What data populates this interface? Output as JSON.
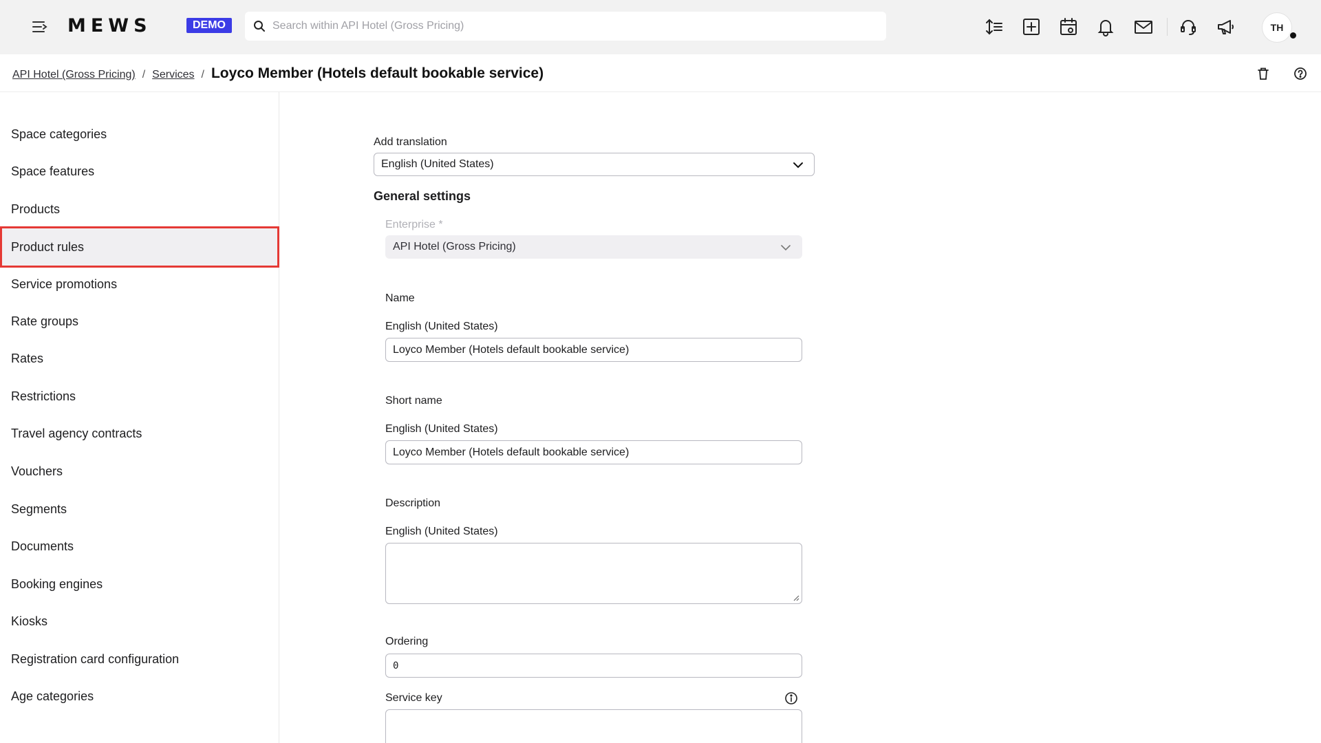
{
  "topbar": {
    "logo": "MEWS",
    "badge": "DEMO",
    "search_placeholder": "Search within API Hotel (Gross Pricing)",
    "avatar_initials": "TH"
  },
  "breadcrumb": {
    "items": [
      "API Hotel (Gross Pricing)",
      "Services"
    ],
    "separator": "/",
    "current": "Loyco Member (Hotels default bookable service)"
  },
  "sidebar": {
    "items": [
      {
        "label": "Space categories"
      },
      {
        "label": "Space features"
      },
      {
        "label": "Products"
      },
      {
        "label": "Product rules",
        "active": true
      },
      {
        "label": "Service promotions"
      },
      {
        "label": "Rate groups"
      },
      {
        "label": "Rates"
      },
      {
        "label": "Restrictions"
      },
      {
        "label": "Travel agency contracts"
      },
      {
        "label": "Vouchers"
      },
      {
        "label": "Segments"
      },
      {
        "label": "Documents"
      },
      {
        "label": "Booking engines"
      },
      {
        "label": "Kiosks"
      },
      {
        "label": "Registration card configuration"
      },
      {
        "label": "Age categories"
      }
    ]
  },
  "form": {
    "add_translation_label": "Add translation",
    "add_translation_value": "English (United States)",
    "general_settings_title": "General settings",
    "enterprise_label": "Enterprise *",
    "enterprise_value": "API Hotel (Gross Pricing)",
    "name_label": "Name",
    "name_lang_label": "English (United States)",
    "name_value": "Loyco Member (Hotels default bookable service)",
    "short_name_label": "Short name",
    "short_name_lang_label": "English (United States)",
    "short_name_value": "Loyco Member (Hotels default bookable service)",
    "description_label": "Description",
    "description_lang_label": "English (United States)",
    "description_value": "",
    "ordering_label": "Ordering",
    "ordering_value": "0",
    "service_key_label": "Service key",
    "service_key_value": ""
  },
  "colors": {
    "accent": "#3c3ce6",
    "highlight_border": "#e53935",
    "topbar_bg": "#f2f2f2"
  }
}
